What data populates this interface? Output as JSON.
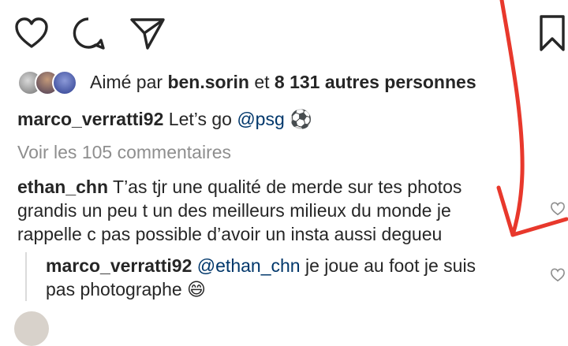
{
  "actions": {
    "like": "heart-icon",
    "comment": "comment-icon",
    "share": "send-icon",
    "save": "bookmark-icon"
  },
  "likes": {
    "prefix": "Aimé par",
    "user": "ben.sorin",
    "connector": "et",
    "count_text": "8 131 autres personnes"
  },
  "caption": {
    "username": "marco_verratti92",
    "text": "Let’s go",
    "mention": "@psg",
    "emoji": "⚽"
  },
  "view_comments": "Voir les 105 commentaires",
  "comment": {
    "username": "ethan_chn",
    "line1": "T’as tjr une qualité de merde sur tes photos",
    "line2": "grandis un peu t un des meilleurs milieux du monde je",
    "line3": "rappelle c pas possible d’avoir un insta aussi degueu"
  },
  "reply": {
    "username": "marco_verratti92",
    "mention": "@ethan_chn",
    "line1": "je joue au foot je suis",
    "line2": "pas photographe",
    "emoji": "😄"
  },
  "colors": {
    "annotation": "#e8382c",
    "link": "#00376b",
    "muted": "#8e8e8e"
  }
}
